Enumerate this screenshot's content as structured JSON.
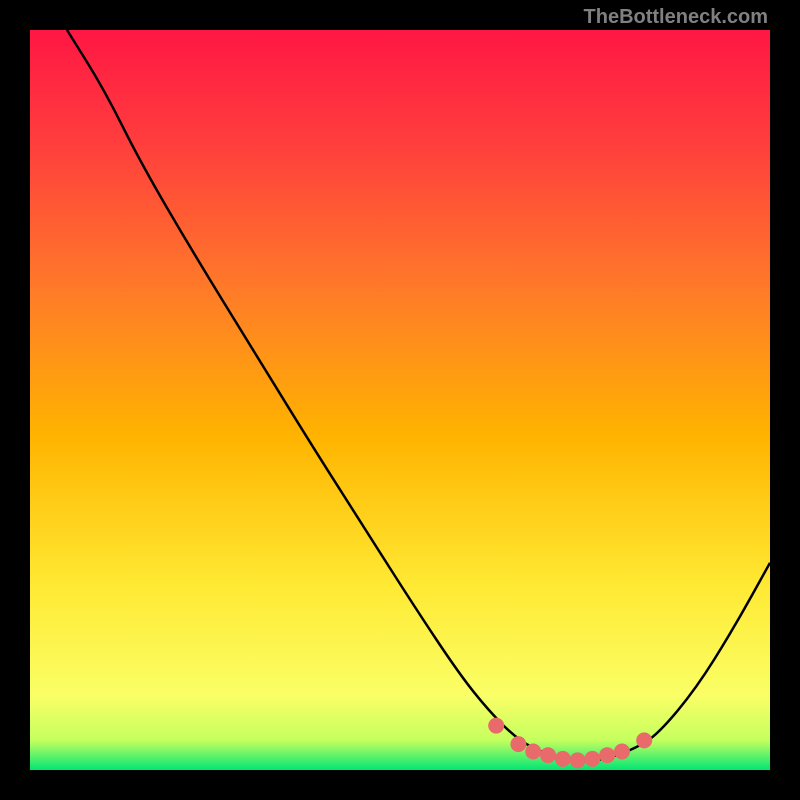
{
  "attribution": "TheBottleneck.com",
  "chart_data": {
    "type": "line",
    "title": "",
    "xlabel": "",
    "ylabel": "",
    "x_range": [
      0,
      100
    ],
    "y_range": [
      0,
      100
    ],
    "gradient_stops": [
      {
        "offset": 0,
        "color": "#ff1744"
      },
      {
        "offset": 15,
        "color": "#ff3d3d"
      },
      {
        "offset": 35,
        "color": "#ff7a29"
      },
      {
        "offset": 55,
        "color": "#ffb400"
      },
      {
        "offset": 75,
        "color": "#ffe933"
      },
      {
        "offset": 90,
        "color": "#faff66"
      },
      {
        "offset": 96,
        "color": "#c4ff5e"
      },
      {
        "offset": 100,
        "color": "#00e676"
      }
    ],
    "series": [
      {
        "name": "bottleneck-curve",
        "color": "#000000",
        "points": [
          {
            "x": 5,
            "y": 100
          },
          {
            "x": 10,
            "y": 92
          },
          {
            "x": 15,
            "y": 82
          },
          {
            "x": 22,
            "y": 70
          },
          {
            "x": 30,
            "y": 57
          },
          {
            "x": 38,
            "y": 44
          },
          {
            "x": 45,
            "y": 33
          },
          {
            "x": 52,
            "y": 22
          },
          {
            "x": 58,
            "y": 13
          },
          {
            "x": 62,
            "y": 8
          },
          {
            "x": 66,
            "y": 4
          },
          {
            "x": 70,
            "y": 2
          },
          {
            "x": 74,
            "y": 1
          },
          {
            "x": 78,
            "y": 1.5
          },
          {
            "x": 82,
            "y": 3
          },
          {
            "x": 85,
            "y": 5
          },
          {
            "x": 90,
            "y": 11
          },
          {
            "x": 95,
            "y": 19
          },
          {
            "x": 100,
            "y": 28
          }
        ]
      }
    ],
    "markers": [
      {
        "x": 63,
        "y": 6,
        "color": "#e86a6a"
      },
      {
        "x": 66,
        "y": 3.5,
        "color": "#e86a6a"
      },
      {
        "x": 68,
        "y": 2.5,
        "color": "#e86a6a"
      },
      {
        "x": 70,
        "y": 2,
        "color": "#e86a6a"
      },
      {
        "x": 72,
        "y": 1.5,
        "color": "#e86a6a"
      },
      {
        "x": 74,
        "y": 1.3,
        "color": "#e86a6a"
      },
      {
        "x": 76,
        "y": 1.5,
        "color": "#e86a6a"
      },
      {
        "x": 78,
        "y": 2,
        "color": "#e86a6a"
      },
      {
        "x": 80,
        "y": 2.5,
        "color": "#e86a6a"
      },
      {
        "x": 83,
        "y": 4,
        "color": "#e86a6a"
      }
    ]
  }
}
